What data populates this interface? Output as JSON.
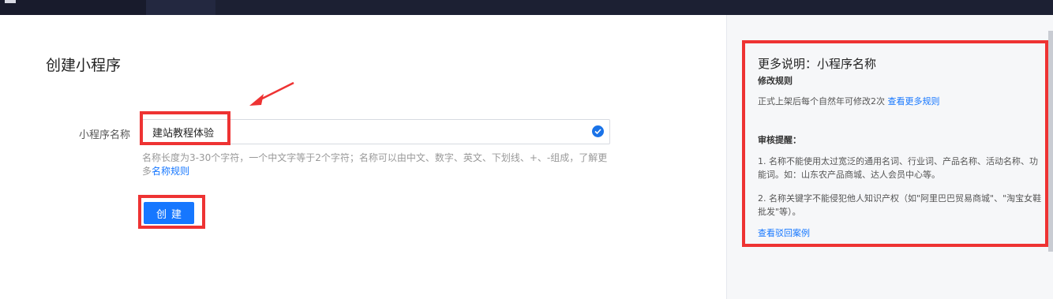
{
  "form": {
    "title": "创建小程序",
    "name_label": "小程序名称",
    "name_value": "建站教程体验",
    "hint_text": "名称长度为3-30个字符，一个中文字等于2个字符；名称可以由中文、数字、英文、下划线、+、-组成，了解更多",
    "hint_link": "名称规则",
    "create_label": "创建"
  },
  "side": {
    "title": "更多说明：小程序名称",
    "modify_heading": "修改规则",
    "modify_text": "正式上架后每个自然年可修改2次",
    "modify_link": "查看更多规则",
    "review_heading": "审核提醒：",
    "review_item1": "1. 名称不能使用太过宽泛的通用名词、行业词、产品名称、活动名称、功能词。如：山东农产品商城、达人会员中心等。",
    "review_item2": "2. 名称关键字不能侵犯他人知识产权（如\"阿里巴巴贸易商城\"、\"淘宝女鞋批发\"等）。",
    "rejected_link": "查看驳回案例"
  },
  "colors": {
    "accent": "#1677ff",
    "highlight": "#ee3333",
    "topbar": "#1c2033"
  },
  "icons": {
    "input_status": "check-circle-icon",
    "annotation": "red-arrow-icon"
  }
}
